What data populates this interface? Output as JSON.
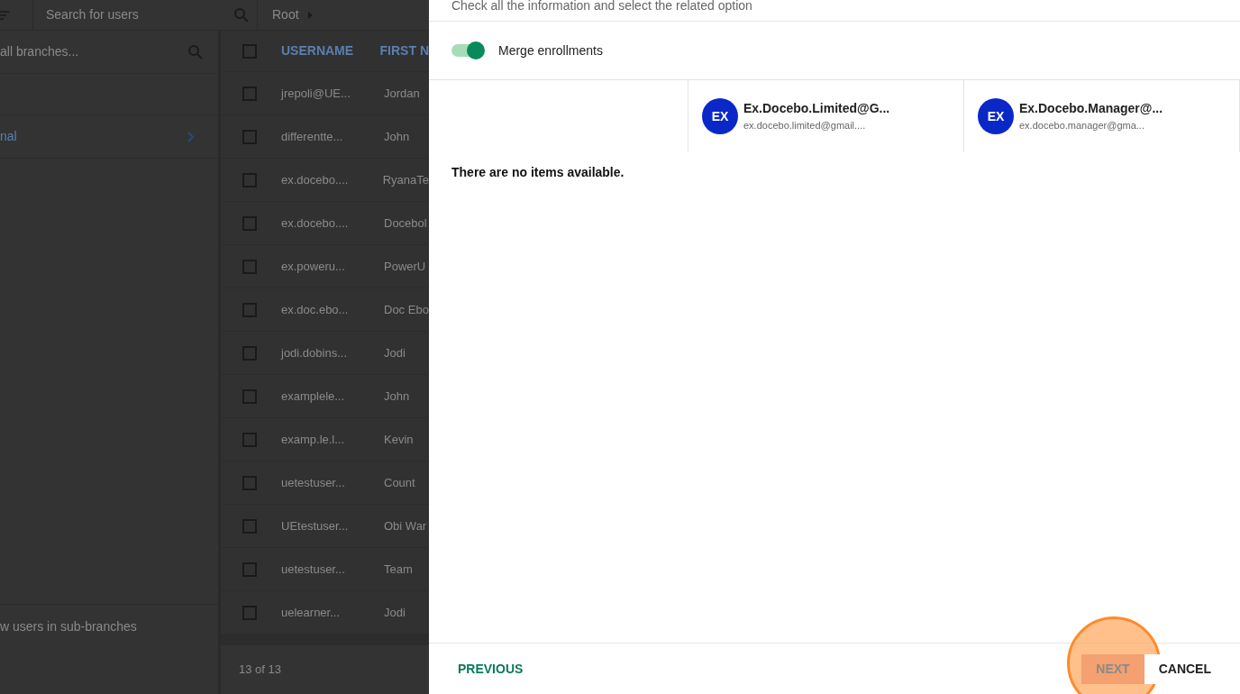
{
  "toolbar": {
    "search_placeholder": "Search for users",
    "breadcrumb": "Root"
  },
  "branches": {
    "search_placeholder": "all branches...",
    "items": [
      {
        "label": "nal",
        "has_children": true
      }
    ],
    "footer": "w users in sub-branches"
  },
  "table": {
    "select_all_checked": false,
    "columns": [
      "USERNAME",
      "FIRST N"
    ],
    "rows": [
      {
        "checked": false,
        "cells": [
          "jrepoli@UE...",
          "Jordan"
        ]
      },
      {
        "checked": false,
        "cells": [
          "differentte...",
          "John"
        ]
      },
      {
        "checked": false,
        "cells": [
          "ex.docebo....",
          "RyanaTe"
        ]
      },
      {
        "checked": false,
        "cells": [
          "ex.docebo....",
          "Docebol"
        ]
      },
      {
        "checked": false,
        "cells": [
          "ex.poweru...",
          "PowerU"
        ]
      },
      {
        "checked": false,
        "cells": [
          "ex.doc.ebo...",
          "Doc Ebo"
        ]
      },
      {
        "checked": false,
        "cells": [
          "jodi.dobins...",
          "Jodi"
        ]
      },
      {
        "checked": false,
        "cells": [
          "examplele...",
          "John"
        ]
      },
      {
        "checked": false,
        "cells": [
          "examp.le.l...",
          "Kevin"
        ]
      },
      {
        "checked": false,
        "cells": [
          "uetestuser...",
          "Count"
        ]
      },
      {
        "checked": false,
        "cells": [
          "UEtestuser...",
          "Obi War"
        ]
      },
      {
        "checked": false,
        "cells": [
          "uetestuser...",
          "Team"
        ]
      },
      {
        "checked": false,
        "cells": [
          "uelearner...",
          "Jodi"
        ]
      }
    ],
    "footer": "13 of 13"
  },
  "modal": {
    "subtitle": "Check all the information and select the related option",
    "toggle": {
      "label": "Merge enrollments",
      "on": true
    },
    "users": [
      {
        "initials": "EX",
        "name": "Ex.Docebo.Limited@G...",
        "email": "ex.docebo.limited@gmail...."
      },
      {
        "initials": "EX",
        "name": "Ex.Docebo.Manager@...",
        "email": "ex.docebo.manager@gma..."
      }
    ],
    "empty_message": "There are no items available.",
    "buttons": [
      {
        "kind": "previous",
        "label": "PREVIOUS",
        "highlighted": false
      },
      {
        "kind": "next",
        "label": "NEXT",
        "highlighted": true
      },
      {
        "kind": "cancel",
        "label": "CANCEL",
        "highlighted": false
      }
    ]
  }
}
